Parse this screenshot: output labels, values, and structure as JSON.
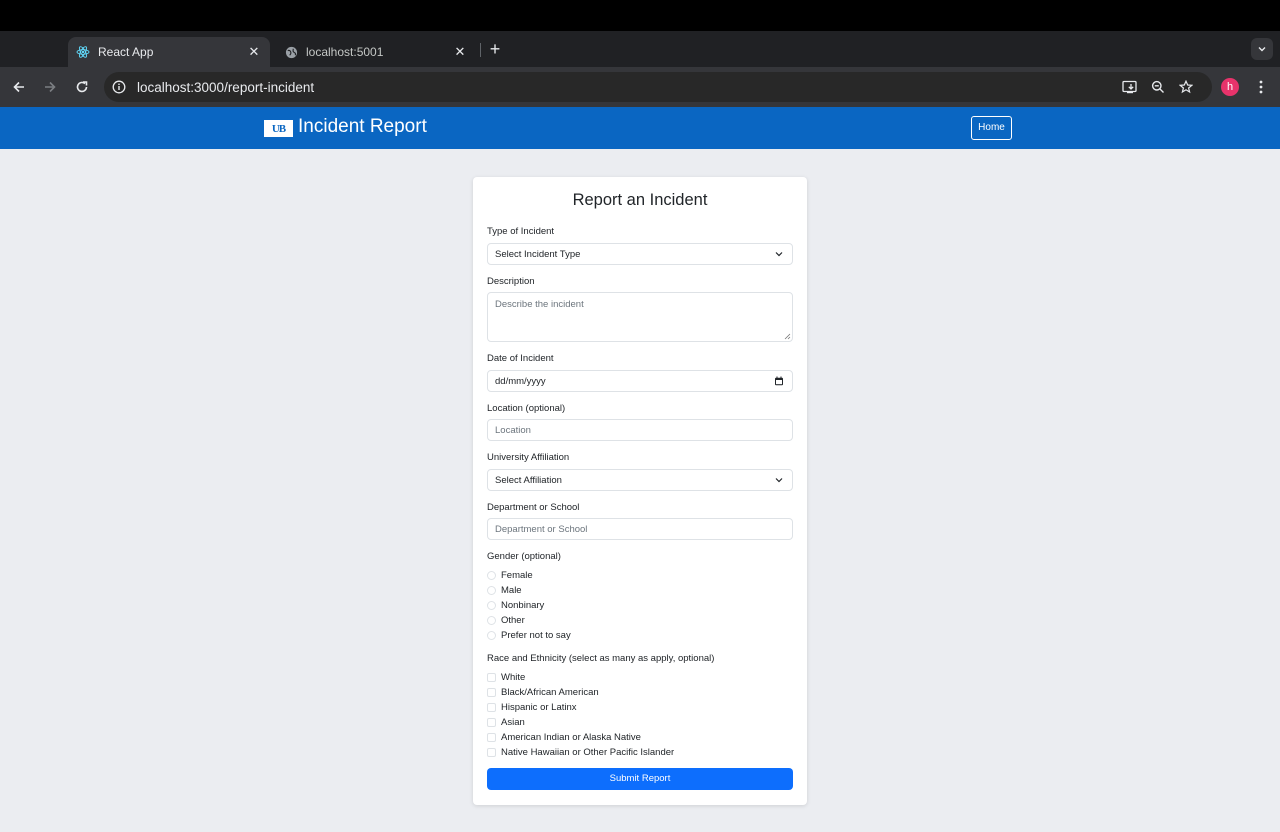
{
  "browser": {
    "tabs": [
      {
        "title": "React App",
        "icon": "react-icon",
        "active": true
      },
      {
        "title": "localhost:5001",
        "icon": "globe-icon",
        "active": false
      }
    ],
    "url": "localhost:3000/report-incident",
    "profile_initial": "h",
    "profile_color": "#e8336b"
  },
  "header": {
    "logo_text": "UB",
    "title": "Incident Report",
    "home_label": "Home",
    "brand_color": "#0a66c2"
  },
  "form": {
    "title": "Report an Incident",
    "incident_type": {
      "label": "Type of Incident",
      "value": "Select Incident Type"
    },
    "description": {
      "label": "Description",
      "placeholder": "Describe the incident"
    },
    "date": {
      "label": "Date of Incident",
      "value": "dd/mm/yyyy"
    },
    "location": {
      "label": "Location (optional)",
      "placeholder": "Location"
    },
    "affiliation": {
      "label": "University Affiliation",
      "value": "Select Affiliation"
    },
    "department": {
      "label": "Department or School",
      "placeholder": "Department or School"
    },
    "gender": {
      "label": "Gender (optional)",
      "options": [
        "Female",
        "Male",
        "Nonbinary",
        "Other",
        "Prefer not to say"
      ]
    },
    "race": {
      "label": "Race and Ethnicity (select as many as apply, optional)",
      "options": [
        "White",
        "Black/African American",
        "Hispanic or Latinx",
        "Asian",
        "American Indian or Alaska Native",
        "Native Hawaiian or Other Pacific Islander"
      ]
    },
    "submit_label": "Submit Report",
    "submit_color": "#0d6efd"
  }
}
